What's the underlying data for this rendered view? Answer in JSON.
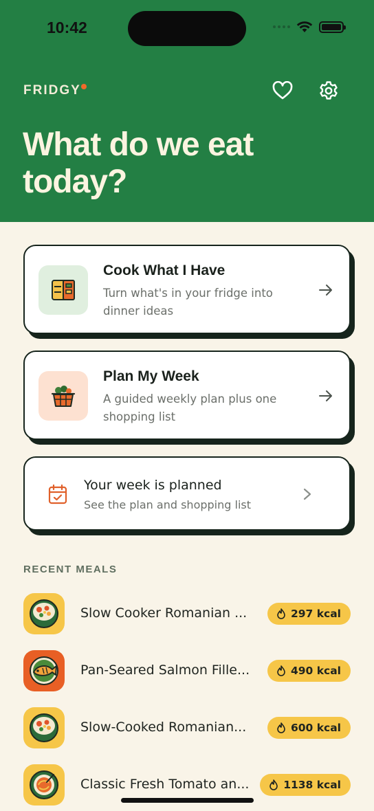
{
  "status_bar": {
    "time": "10:42"
  },
  "header": {
    "brand": "FRIDGY",
    "title_line1": "What do we eat",
    "title_line2": "today?"
  },
  "cards": {
    "cook": {
      "title": "Cook What I Have",
      "subtitle": "Turn what's in your fridge into dinner ideas"
    },
    "plan": {
      "title": "Plan My Week",
      "subtitle": "A guided weekly plan plus one shopping list"
    },
    "week": {
      "title": "Your week is planned",
      "subtitle": "See the plan and shopping list"
    }
  },
  "recent": {
    "label": "RECENT MEALS",
    "meals": [
      {
        "name": "Slow Cooker Romanian ...",
        "kcal": "297 kcal",
        "thumb": "soup-bowl-icon"
      },
      {
        "name": "Pan-Seared Salmon Fille...",
        "kcal": "490 kcal",
        "thumb": "fish-plate-icon"
      },
      {
        "name": "Slow-Cooked Romanian...",
        "kcal": "600 kcal",
        "thumb": "soup-bowl-icon"
      },
      {
        "name": "Classic Fresh Tomato an...",
        "kcal": "1138 kcal",
        "thumb": "pasta-plate-icon"
      }
    ]
  },
  "colors": {
    "header_bg": "#237f44",
    "page_bg": "#f9f4e8",
    "accent_orange": "#f06a2a",
    "kcal_pill": "#f6c648"
  }
}
